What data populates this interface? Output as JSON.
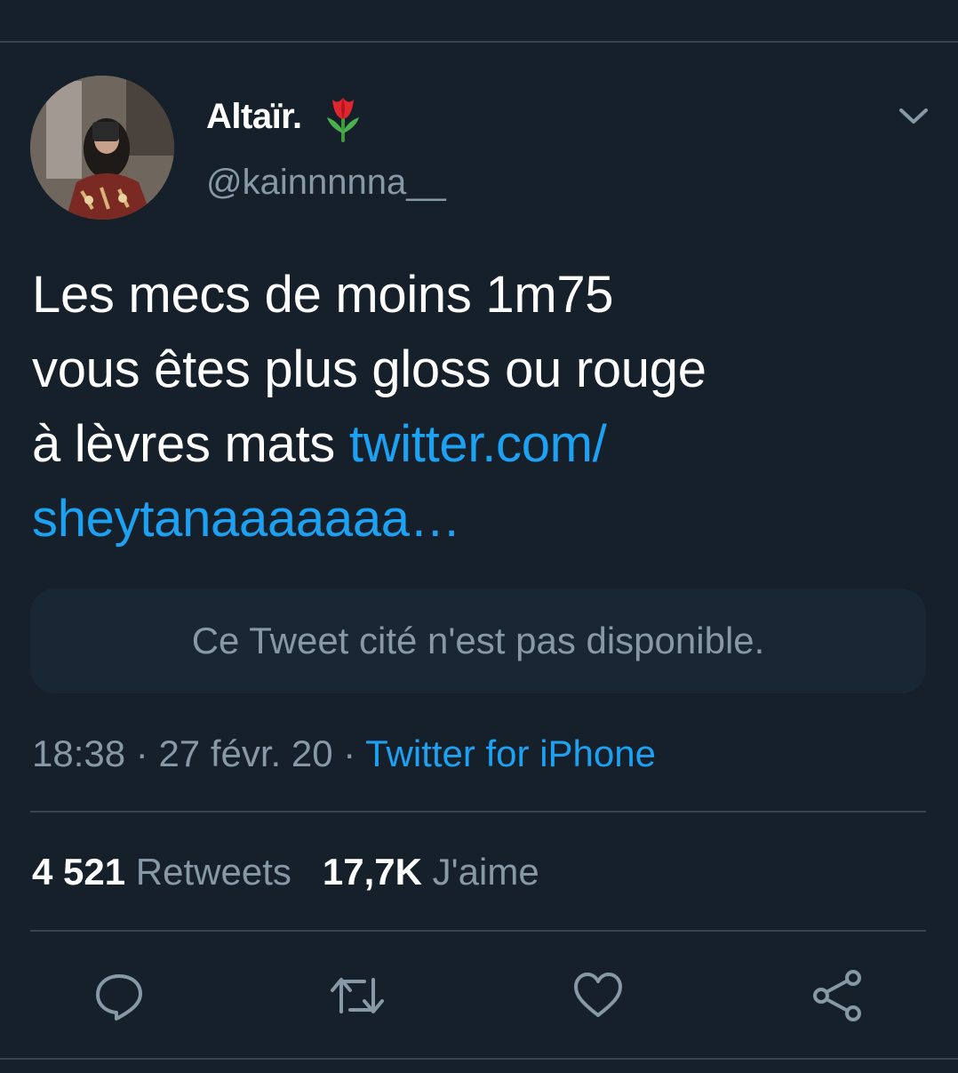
{
  "tweet": {
    "display_name": "Altaïr.",
    "handle": "@kainnnnna__",
    "text_lines": [
      "Les mecs de moins 1m75",
      "vous êtes plus gloss ou rouge",
      "à lèvres mats "
    ],
    "link_part1": "twitter.com/",
    "link_part2": "sheytanaaaaaaa…",
    "quoted_unavailable": "Ce Tweet cité n'est pas disponible.",
    "time": "18:38",
    "date": "27 févr. 20",
    "separator": " · ",
    "source": "Twitter for iPhone",
    "retweets_count": "4 521",
    "retweets_label": "Retweets",
    "likes_count": "17,7K",
    "likes_label": "J'aime"
  },
  "icons": {
    "name_emoji": "tulip-icon",
    "menu": "chevron-down-icon",
    "actions": [
      "reply-icon",
      "retweet-icon",
      "like-icon",
      "share-icon"
    ]
  },
  "colors": {
    "background": "#15202b",
    "link": "#1da1f2",
    "secondary_text": "#8899a6",
    "divider": "#38444d",
    "quote_box": "#192734"
  }
}
